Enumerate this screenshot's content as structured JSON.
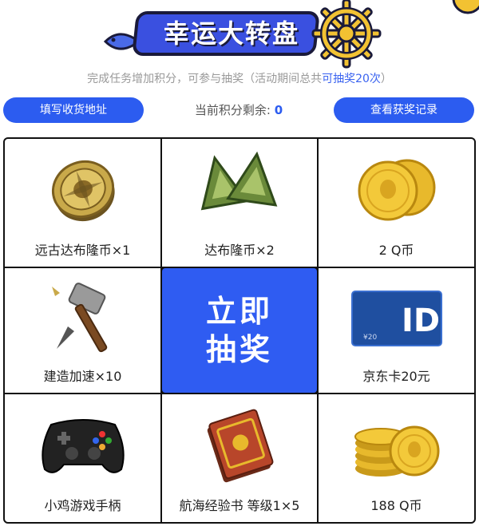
{
  "header": {
    "title": "幸运大转盘"
  },
  "subtitle": {
    "text": "完成任务增加积分，可参与抽奖（活动期间总共",
    "highlight": "可抽奖20次",
    "suffix": "）"
  },
  "actions": {
    "address_button": "填写收货地址",
    "points_label": "当前积分剩余:",
    "points_value": "0",
    "records_button": "查看获奖记录"
  },
  "draw_button": "立即抽奖",
  "prizes": [
    {
      "label": "远古达布隆币×1",
      "icon": "ancient-coin-icon"
    },
    {
      "label": "达布隆币×2",
      "icon": "green-coins-icon"
    },
    {
      "label": "2 Q币",
      "icon": "qcoin-pair-icon"
    },
    {
      "label": "建造加速×10",
      "icon": "hammer-icon"
    },
    {
      "label": "京东卡20元",
      "icon": "jd-card-icon"
    },
    {
      "label": "小鸡游戏手柄",
      "icon": "gamepad-icon"
    },
    {
      "label": "航海经验书 等级1×5",
      "icon": "book-icon"
    },
    {
      "label": "188 Q币",
      "icon": "qcoin-stack-icon"
    }
  ],
  "jd_card": {
    "amount": "¥20"
  },
  "colors": {
    "primary": "#2f5cf2",
    "gold": "#e8b92c",
    "banner": "#3a50e0"
  }
}
